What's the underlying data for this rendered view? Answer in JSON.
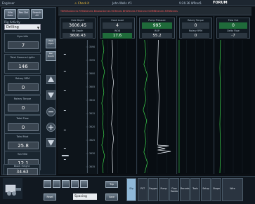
{
  "titlebar": {
    "app": "Engineer",
    "warning": "⚠ Check it",
    "well": "John Wells #1",
    "stamp": "9:26:36  WPnet1",
    "brand": "FORUM"
  },
  "left": {
    "top_buttons": [
      "Alfa\nHole",
      "Rev\nDel",
      "Search\nAll"
    ],
    "activity_label": "Rig Activity",
    "activity_value": "Drilling",
    "metrics": [
      {
        "label": "Gyro Idle",
        "value": "7"
      },
      {
        "label": "Total Gamma Lights",
        "value": "146"
      },
      {
        "label": "Rotary RPM",
        "value": "0"
      },
      {
        "label": "Rotary Torque",
        "value": "0"
      },
      {
        "label": "Total Flow",
        "value": "0"
      },
      {
        "label": "Total Mud",
        "value": "25.8"
      },
      {
        "label": "Ton Mile",
        "value": "12.1"
      },
      {
        "label": "Block Height",
        "value": "34.63"
      }
    ],
    "side_buttons": [
      "Pipe\nOpen",
      "Rec\nZoom"
    ]
  },
  "tracks": {
    "tabs_line": "TNROBxGenres  RTSNGenres  BinaiocGenres  RGTenres  BHGTenres  TRGenrix  ECMMBGenres  NTBSenres",
    "columns": [
      {
        "label1": "Hole Depth",
        "value1": "3606.45",
        "label2": "Bit Depth",
        "value2": "3606.43"
      },
      {
        "label1": "Hook Load",
        "value1": "4",
        "label2": "WOB",
        "value2": "17.6"
      },
      {
        "label1": "Pump Pressure",
        "value1": "995",
        "label2": "ROP",
        "value2": "55.2"
      },
      {
        "label1": "Rotary Torque",
        "value1": "0",
        "label2": "Rotary RPM",
        "value2": "0"
      },
      {
        "label1": "Flow Out",
        "value1": "0",
        "label2": "Delta Flow",
        "value2": "-7"
      }
    ],
    "depths": [
      "3590",
      "3595",
      "3600",
      "3605",
      "3610",
      "3615",
      "3620",
      "3625",
      "3630",
      "3635"
    ]
  },
  "bottom": {
    "space_value": "Spacing",
    "small_buttons": [
      "Reset",
      "Trip",
      "Slip",
      "Save"
    ],
    "tabs": [
      "PVT",
      "Oxygen",
      "Pump",
      "Flow\nPaddle",
      "Records",
      "Tools",
      "Setup",
      "Shape",
      "Wire"
    ],
    "bop": "BOP\nStat"
  }
}
